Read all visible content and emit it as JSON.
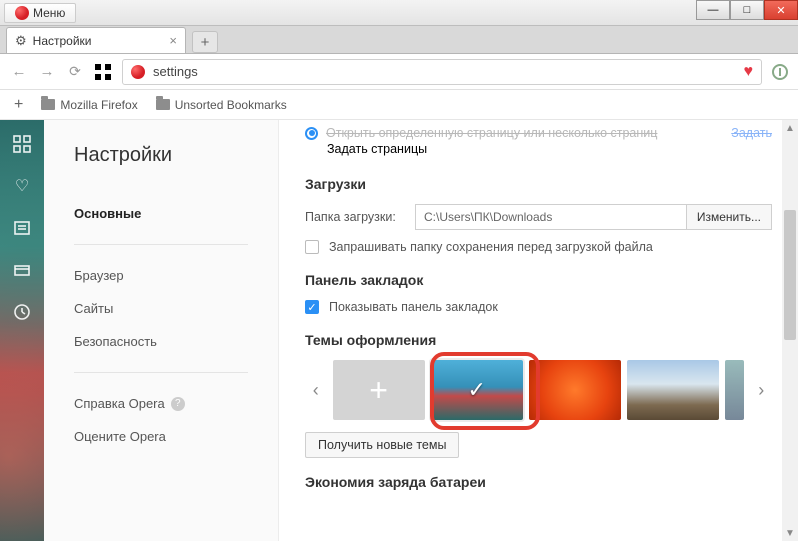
{
  "window": {
    "menu_label": "Меню",
    "minimize": "—",
    "maximize": "□",
    "close": "✕"
  },
  "tab": {
    "title": "Настройки",
    "close": "×",
    "newtab": "+"
  },
  "nav": {
    "address_value": "settings"
  },
  "bookmarks_bar": {
    "add": "+",
    "items": [
      {
        "label": "Mozilla Firefox"
      },
      {
        "label": "Unsorted Bookmarks"
      }
    ]
  },
  "sidebar": {
    "title": "Настройки",
    "items": [
      {
        "label": "Основные",
        "active": true
      },
      {
        "label": "Браузер"
      },
      {
        "label": "Сайты"
      },
      {
        "label": "Безопасность"
      }
    ],
    "help_label": "Справка Opera",
    "rate_label": "Оцените Opera"
  },
  "startup": {
    "option_scratched": "Открыть определенную страницу или несколько страниц",
    "set_pages_link": "Задать страницы"
  },
  "downloads": {
    "heading": "Загрузки",
    "path_label": "Папка загрузки:",
    "path_value": "C:\\Users\\ПК\\Downloads",
    "change_btn": "Изменить...",
    "ask_label": "Запрашивать папку сохранения перед загрузкой файла"
  },
  "bookmarks_panel": {
    "heading": "Панель закладок",
    "show_label": "Показывать панель закладок"
  },
  "themes": {
    "heading": "Темы оформления",
    "prev": "‹",
    "next": "›",
    "add": "+",
    "get_more_btn": "Получить новые темы"
  },
  "battery": {
    "heading": "Экономия заряда батареи"
  }
}
